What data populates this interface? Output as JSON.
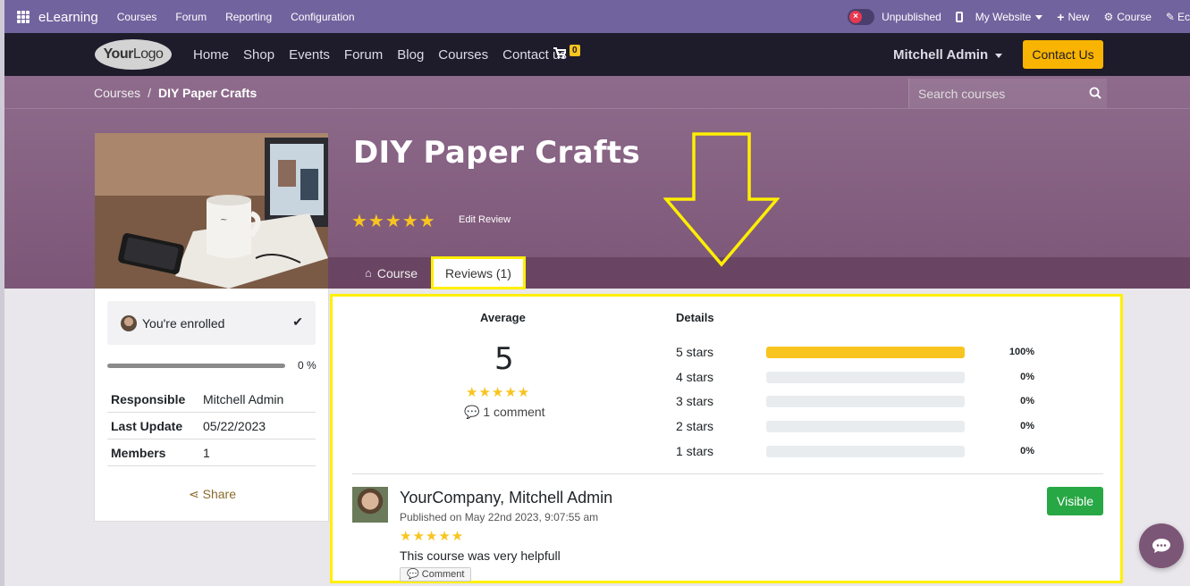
{
  "topbar": {
    "app": "eLearning",
    "menu": [
      "Courses",
      "Forum",
      "Reporting",
      "Configuration"
    ],
    "unpublished": "Unpublished",
    "my_website": "My Website",
    "new": "New",
    "course": "Course",
    "edit": "Ec"
  },
  "sitenav": {
    "logo_bold": "Your",
    "logo_rest": "Logo",
    "links": [
      "Home",
      "Shop",
      "Events",
      "Forum",
      "Blog",
      "Courses",
      "Contact us"
    ],
    "cart_count": "0",
    "user": "Mitchell Admin",
    "contact_button": "Contact Us"
  },
  "breadcrumb": {
    "parent": "Courses",
    "separator": "/",
    "current": "DIY Paper Crafts"
  },
  "search": {
    "placeholder": "Search courses"
  },
  "course": {
    "title": "DIY Paper Crafts",
    "stars": "★★★★★",
    "edit_review": "Edit Review",
    "tab_course": "Course",
    "tab_reviews": "Reviews (1)"
  },
  "sidebar": {
    "enrolled": "You're enrolled",
    "progress_percent": 0,
    "progress_label": "0 %",
    "meta": [
      {
        "key": "Responsible",
        "value": "Mitchell Admin"
      },
      {
        "key": "Last Update",
        "value": "05/22/2023"
      },
      {
        "key": "Members",
        "value": "1"
      }
    ],
    "share": "Share"
  },
  "reviews": {
    "average_heading": "Average",
    "average_value": "5",
    "average_stars": "★★★★★",
    "comments": "1 comment",
    "details_heading": "Details",
    "details": [
      {
        "label": "5 stars",
        "percent": 100,
        "pct_label": "100%"
      },
      {
        "label": "4 stars",
        "percent": 0,
        "pct_label": "0%"
      },
      {
        "label": "3 stars",
        "percent": 0,
        "pct_label": "0%"
      },
      {
        "label": "2 stars",
        "percent": 0,
        "pct_label": "0%"
      },
      {
        "label": "1 stars",
        "percent": 0,
        "pct_label": "0%"
      }
    ],
    "review": {
      "author": "YourCompany, Mitchell Admin",
      "date": "Published on May 22nd 2023, 9:07:55 am",
      "stars": "★★★★★",
      "text": "This course was very helpfull",
      "comment_button": "Comment",
      "visible_button": "Visible"
    }
  },
  "colors": {
    "topbar": "#71639e",
    "sitenav": "#1e1b2b",
    "hero": "#7c5677",
    "accent_yellow": "#f8c41f",
    "highlight": "#ffef00",
    "visible_green": "#28a745"
  }
}
